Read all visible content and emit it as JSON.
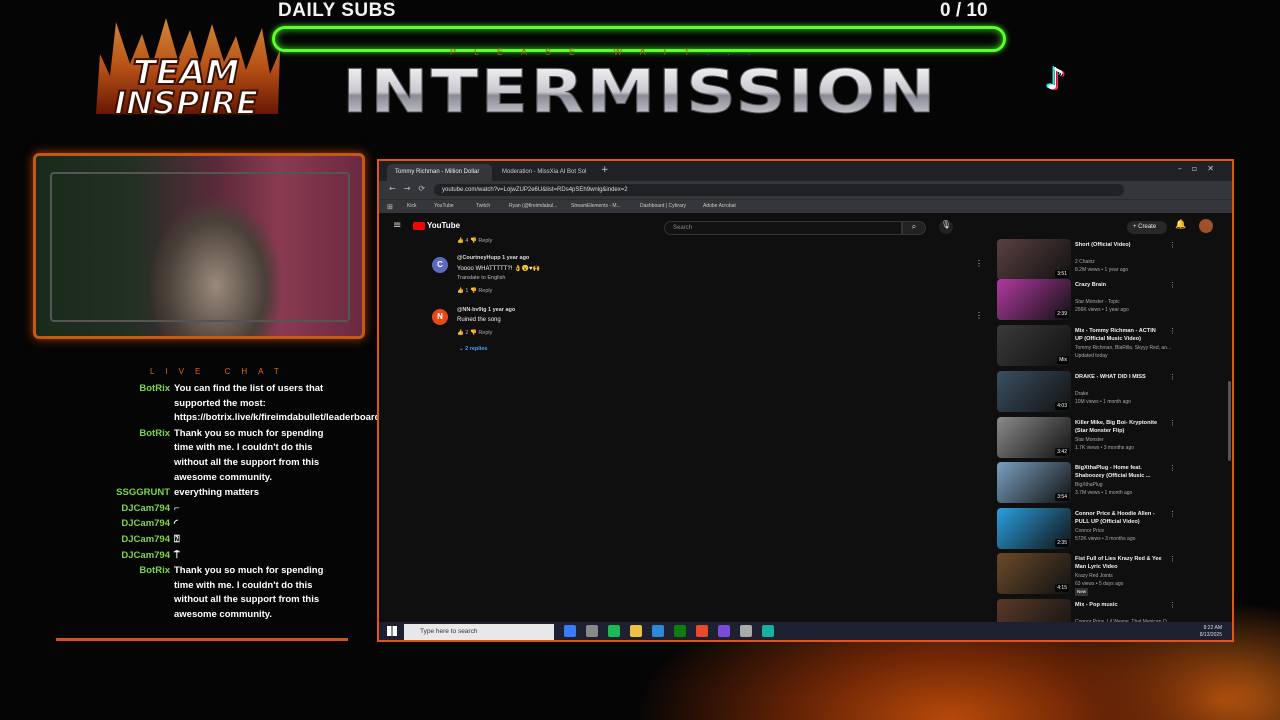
{
  "overlay": {
    "subs_label": "DAILY SUBS",
    "subs_count": "0 / 10",
    "subs_progress": 0,
    "please_wait": "PLEASE WAIT...",
    "title": "INTERMISSION",
    "logo_line1": "TEAM",
    "logo_line2": "INSPIRE",
    "tiktok_icon": "tiktok-icon",
    "chat_title": "LIVE CHAT"
  },
  "chat": [
    {
      "user": "BotRix",
      "text": "You can find the list of users that supported the most: https://botrix.live/k/fireimdabullet/leaderboard",
      "color": "#7cd64a"
    },
    {
      "user": "BotRix",
      "text": "Thank you so much for spending time with me. I couldn't do this without all the support from this awesome community.",
      "color": "#7cd64a"
    },
    {
      "user": "SSGGRUNT",
      "text": "everything matters",
      "color": "#7cd64a"
    },
    {
      "user": "DJCam794",
      "text": "⌐",
      "color": "#7cd64a"
    },
    {
      "user": "DJCam794",
      "text": "◜",
      "color": "#7cd64a"
    },
    {
      "user": "DJCam794",
      "text": "⍰",
      "color": "#7cd64a"
    },
    {
      "user": "DJCam794",
      "text": "⍑",
      "color": "#7cd64a"
    },
    {
      "user": "BotRix",
      "text": "Thank you so much for spending time with me. I couldn't do this without all the support from this awesome community.",
      "color": "#7cd64a"
    }
  ],
  "browser": {
    "tab1": "Tommy Richman - Million Dollar",
    "tab2": "Moderation - MissXia AI Bot Sol",
    "url": "youtube.com/watch?v=LojwZUP2e6U&list=RDs4pSEh9wnlg&index=2",
    "bookmarks": [
      "Kick",
      "YouTube",
      "Twitch",
      "Ryan (@fireimdabul...",
      "StreamElements - M...",
      "Dashboard | Cybrary",
      "Adobe Acrobat"
    ],
    "youtube_logo": "YouTube",
    "search_placeholder": "Search",
    "create_label": "+ Create",
    "comments": [
      {
        "initial": "C",
        "author": "@CourtneyHupp",
        "age": "1 year ago",
        "text": "Yoooo WHATTTTT?! 👌😮♥🙌",
        "sub": "Translate to English",
        "likes": "1",
        "reply": "Reply",
        "color": "#5c6bc0"
      },
      {
        "initial": "N",
        "author": "@NN-bv9ig",
        "age": "1 year ago",
        "text": "Ruined the song",
        "sub": "",
        "likes": "2",
        "reply": "Reply",
        "color": "#e64a19"
      }
    ],
    "prev_likes": "4",
    "prev_reply": "Reply",
    "replies_link": "⌄ 2 replies",
    "videos": [
      {
        "title": "Short (Official Video)",
        "channel": "2 Chainz",
        "meta": "8.2M views • 1 year ago",
        "dur": "3:51",
        "thumb": "#5a4040"
      },
      {
        "title": "Crazy Brain",
        "channel": "Star Monster - Topic",
        "meta": "256K views • 1 year ago",
        "dur": "2:39",
        "thumb": "#b03aa0"
      },
      {
        "title": "Mix - Tommy Richman - ACTIN UP (Official Music Video)",
        "channel": "Tommy Richman, BlaRilla, Skyyy Red, an...",
        "meta": "Updated today",
        "dur": "Mix",
        "thumb": "#3a3a3a"
      },
      {
        "title": "DRAKE - WHAT DID I MISS",
        "channel": "Drake",
        "meta": "10M views • 1 month ago",
        "dur": "4:03",
        "thumb": "#3a5060"
      },
      {
        "title": "Killer Mike, Big Boi- Kryptonite (Star Monster Flip)",
        "channel": "Star Monster",
        "meta": "1.7K views • 3 months ago",
        "dur": "3:42",
        "thumb": "#8a8a8a"
      },
      {
        "title": "BigXthaPlug - Home feat. Shaboozey (Official Music ...",
        "channel": "BigXthaPlug",
        "meta": "3.7M views • 1 month ago",
        "dur": "3:54",
        "thumb": "#7aa0c0"
      },
      {
        "title": "Connor Price & Hoodie Allen - PULL UP (Official Video)",
        "channel": "Connor Price",
        "meta": "572K views • 3 months ago",
        "dur": "2:35",
        "thumb": "#2aa0e0"
      },
      {
        "title": "Fist Full of Lies Krazy Red & Yee Man Lyric Video",
        "channel": "Krazy Red Joints",
        "meta": "63 views • 5 days ago",
        "dur": "4:15",
        "thumb": "#6a4a2a",
        "badge": "New"
      },
      {
        "title": "Mix - Pop music",
        "channel": "Connor Price, Lil Wayne, That Mexican O...",
        "meta": "",
        "dur": "",
        "thumb": "#5a3a2a"
      }
    ],
    "taskbar_search": "Type here to search",
    "clock_time": "8:22 AM",
    "clock_date": "8/13/2025"
  }
}
